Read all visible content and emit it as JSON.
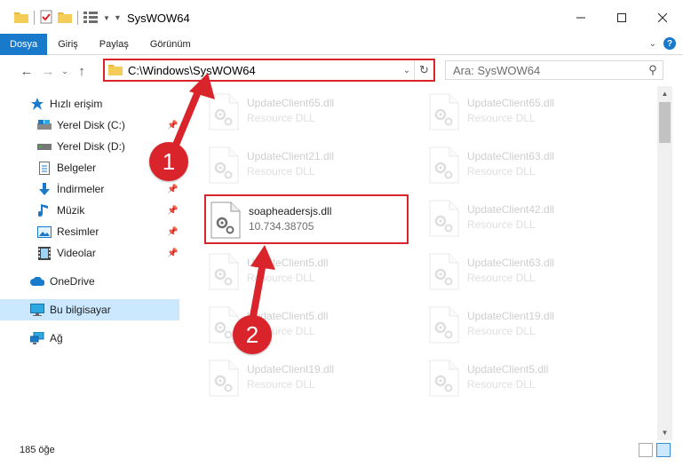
{
  "window": {
    "title": "SysWOW64"
  },
  "ribbon": {
    "tabs": [
      "Dosya",
      "Giriş",
      "Paylaş",
      "Görünüm"
    ]
  },
  "address": {
    "path": "C:\\Windows\\SysWOW64"
  },
  "search": {
    "placeholder": "Ara: SysWOW64"
  },
  "sidebar": {
    "items": [
      {
        "label": "Hızlı erişim",
        "icon": "star-icon"
      },
      {
        "label": "Yerel Disk (C:)",
        "icon": "drive-icon",
        "pinned": true
      },
      {
        "label": "Yerel Disk (D:)",
        "icon": "drive-icon",
        "pinned": false
      },
      {
        "label": "Belgeler",
        "icon": "document-icon",
        "pinned": true
      },
      {
        "label": "İndirmeler",
        "icon": "download-icon",
        "pinned": true
      },
      {
        "label": "Müzik",
        "icon": "music-icon",
        "pinned": true
      },
      {
        "label": "Resimler",
        "icon": "pictures-icon",
        "pinned": true
      },
      {
        "label": "Videolar",
        "icon": "video-icon",
        "pinned": true
      },
      {
        "label": "OneDrive",
        "icon": "cloud-icon"
      },
      {
        "label": "Bu bilgisayar",
        "icon": "computer-icon",
        "selected": true
      },
      {
        "label": "Ağ",
        "icon": "network-icon"
      }
    ]
  },
  "files": [
    {
      "name": "UpdateClient65.dll",
      "sub": "Resource DLL"
    },
    {
      "name": "UpdateClient65.dll",
      "sub": "Resource DLL"
    },
    {
      "name": "UpdateClient21.dll",
      "sub": "Resource DLL"
    },
    {
      "name": "UpdateClient63.dll",
      "sub": "Resource DLL"
    },
    {
      "name": "soapheadersjs.dll",
      "sub": "10.734.38705",
      "highlighted": true
    },
    {
      "name": "UpdateClient42.dll",
      "sub": "Resource DLL"
    },
    {
      "name": "UpdateClient5.dll",
      "sub": "Resource DLL"
    },
    {
      "name": "UpdateClient63.dll",
      "sub": "Resource DLL"
    },
    {
      "name": "UpdateClient5.dll",
      "sub": "Resource DLL"
    },
    {
      "name": "UpdateClient19.dll",
      "sub": "Resource DLL"
    },
    {
      "name": "UpdateClient19.dll",
      "sub": "Resource DLL"
    },
    {
      "name": "UpdateClient5.dll",
      "sub": "Resource DLL"
    }
  ],
  "status": {
    "item_count": "185 öğe"
  },
  "annotations": {
    "badge1": "1",
    "badge2": "2"
  },
  "colors": {
    "accent": "#1979ca",
    "highlight": "#d9242b",
    "selection": "#cce8ff"
  }
}
